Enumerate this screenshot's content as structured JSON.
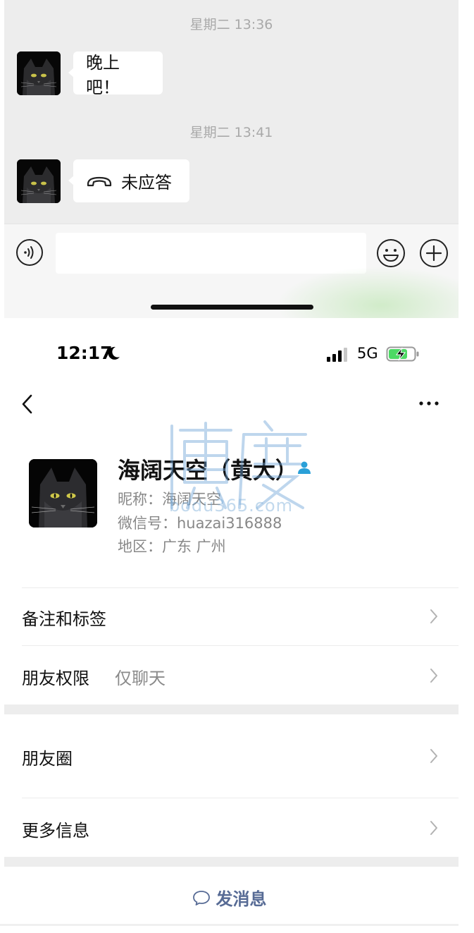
{
  "chat": {
    "messages": [
      {
        "time": "星期二 13:36",
        "text": "晚上吧！"
      },
      {
        "time": "星期二 13:41",
        "text": "未应答",
        "icon": "hang-up-phone-icon"
      }
    ],
    "input": {
      "value": "",
      "placeholder": ""
    },
    "icons": [
      "voice-input-icon",
      "emoji-icon",
      "plus-icon"
    ]
  },
  "status_bar": {
    "time": "12:17",
    "network": "5G",
    "icons": [
      "moon-icon",
      "signal-icon",
      "battery-charging-icon"
    ]
  },
  "nav": {
    "icons": [
      "back-icon",
      "more-icon"
    ]
  },
  "profile": {
    "name": "海阔天空（黄大）",
    "nickname": "昵称：海阔天空",
    "wechat_id": "微信号：huazai316888",
    "region": "地区：广东 广州"
  },
  "watermark": {
    "text": "bodu365.com"
  },
  "menu": {
    "remark": "备注和标签",
    "permission_label": "朋友权限",
    "permission_value": "仅聊天",
    "moments": "朋友圈",
    "more_info": "更多信息"
  },
  "actions": {
    "send_message": "发消息"
  },
  "colors": {
    "chat_background": "#ededed",
    "link_blue": "#576b95",
    "verified_blue": "#2aa0d8",
    "battery_green": "#4cd964"
  }
}
